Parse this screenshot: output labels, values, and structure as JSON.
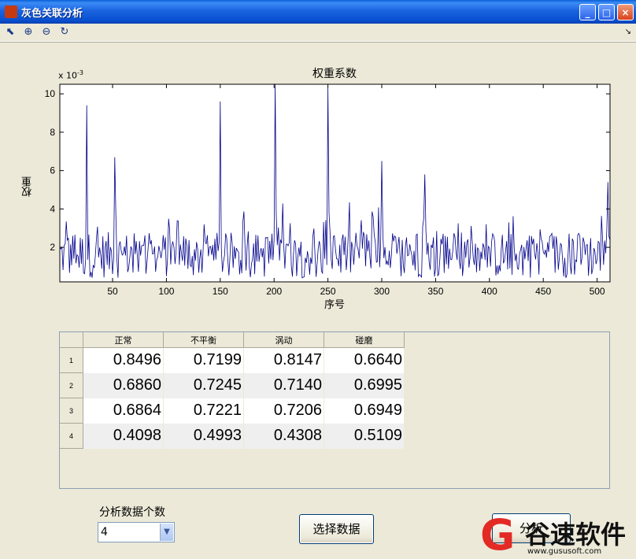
{
  "window": {
    "title": "灰色关联分析",
    "minimize": "_",
    "maximize": "□",
    "close": "×"
  },
  "toolbar": {
    "icons": [
      "edit-plot-icon",
      "zoom-in-icon",
      "zoom-out-icon",
      "rotate-icon"
    ],
    "dock": "↘"
  },
  "chart_data": {
    "type": "line",
    "title": "权重系数",
    "xlabel": "序号",
    "ylabel": "权重",
    "y_scale_label": "x 10",
    "y_scale_exponent": "-3",
    "xlim": [
      1,
      512
    ],
    "ylim": [
      0.2,
      10.5
    ],
    "xticks": [
      50,
      100,
      150,
      200,
      250,
      300,
      350,
      400,
      450,
      500
    ],
    "yticks": [
      2,
      4,
      6,
      8,
      10
    ],
    "color": "#00008b",
    "series_length": 512,
    "peaks": [
      [
        26,
        9.4
      ],
      [
        52,
        6.7
      ],
      [
        150,
        9.6
      ],
      [
        201,
        10.5
      ],
      [
        250,
        10.3
      ],
      [
        300,
        6.5
      ],
      [
        340,
        5.8
      ],
      [
        510,
        5.4
      ]
    ]
  },
  "table": {
    "columns": [
      "正常",
      "不平衡",
      "涡动",
      "碰磨"
    ],
    "rows": [
      {
        "label": "1",
        "values": [
          "0.8496",
          "0.7199",
          "0.8147",
          "0.6640"
        ]
      },
      {
        "label": "2",
        "values": [
          "0.6860",
          "0.7245",
          "0.7140",
          "0.6995"
        ]
      },
      {
        "label": "3",
        "values": [
          "0.6864",
          "0.7221",
          "0.7206",
          "0.6949"
        ]
      },
      {
        "label": "4",
        "values": [
          "0.4098",
          "0.4993",
          "0.4308",
          "0.5109"
        ]
      }
    ]
  },
  "controls": {
    "count_label": "分析数据个数",
    "count_value": "4",
    "select_data_button": "选择数据",
    "right_button": "分析"
  },
  "watermark": {
    "text": "谷速软件",
    "logo": "G",
    "url": "www.gususoft.com",
    "color": "#e32a24"
  }
}
